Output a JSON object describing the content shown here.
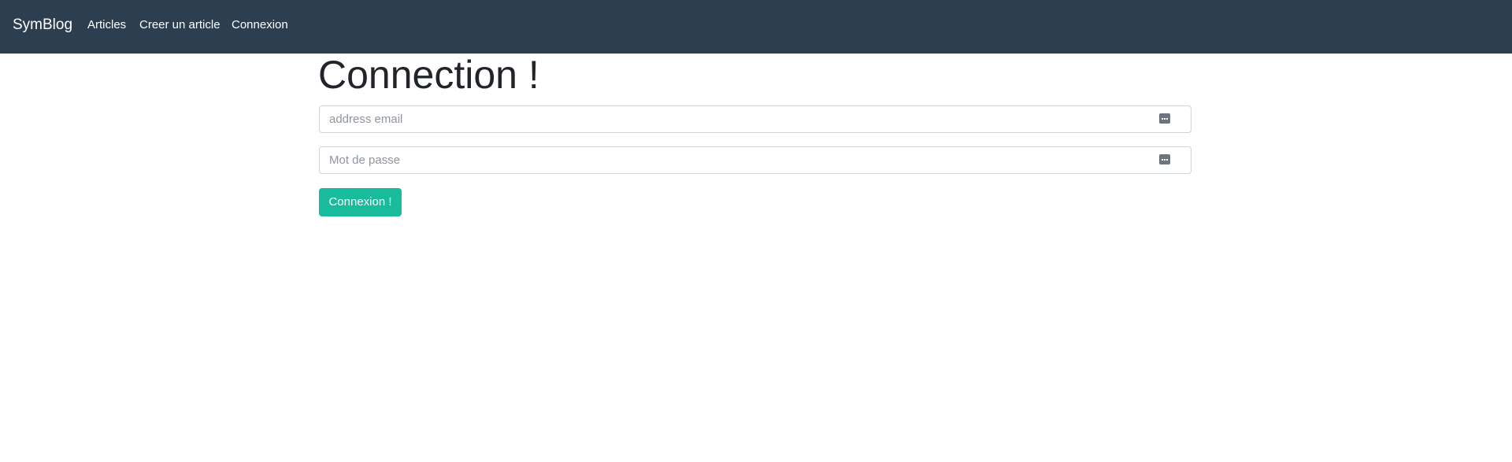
{
  "navbar": {
    "brand": "SymBlog",
    "links": [
      {
        "label": "Articles"
      },
      {
        "label": "Creer un article"
      },
      {
        "label": "Connexion"
      }
    ]
  },
  "page": {
    "title": "Connection !"
  },
  "form": {
    "email": {
      "placeholder": "address email",
      "value": ""
    },
    "password": {
      "placeholder": "Mot de passe",
      "value": ""
    },
    "submit_label": "Connexion !"
  },
  "icons": {
    "field_icon": "password-manager-icon"
  },
  "colors": {
    "navbar_bg": "#2c3e50",
    "primary_button": "#18bc9c",
    "title_text": "#212529"
  }
}
